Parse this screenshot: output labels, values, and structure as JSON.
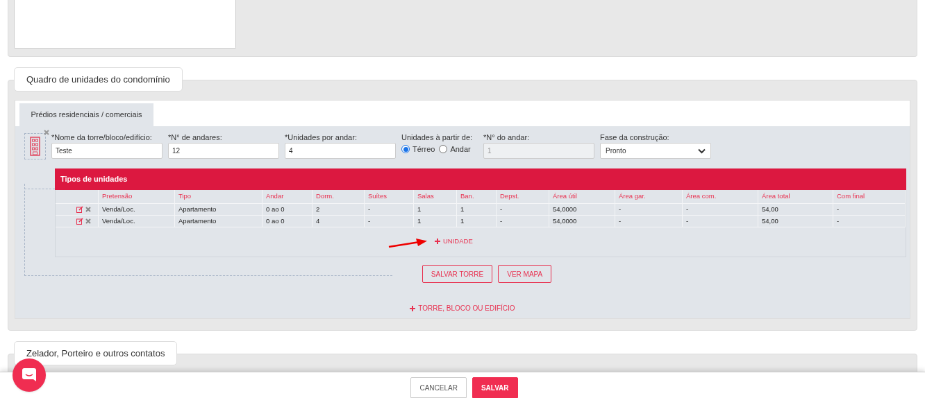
{
  "section_condominio": {
    "title": "Quadro de unidades do condomínio",
    "tabs": [
      {
        "label": "Prédios residenciais / comerciais",
        "selected": true
      }
    ],
    "fields": [
      {
        "kind": "text",
        "label": "*Nome da torre/bloco/edifício:",
        "value": "Teste"
      },
      {
        "kind": "text",
        "label": "*N° de andares:",
        "value": "12"
      },
      {
        "kind": "text",
        "label": "*Unidades por andar:",
        "value": "4"
      },
      {
        "kind": "radio",
        "label": "Unidades à partir de:",
        "options": [
          {
            "label": "Térreo",
            "selected": true
          },
          {
            "label": "Andar",
            "selected": false
          }
        ]
      },
      {
        "kind": "disabled",
        "label": "*N° do andar:",
        "value": "1"
      },
      {
        "kind": "select",
        "label": "Fase da construção:",
        "value": "Pronto"
      }
    ],
    "units": {
      "title": "Tipos de unidades",
      "columns": [
        "Pretensão",
        "Tipo",
        "Andar",
        "Dorm.",
        "Suítes",
        "Salas",
        "Ban.",
        "Depst.",
        "Área útil",
        "Área gar.",
        "Área com.",
        "Área total",
        "Com final"
      ],
      "rows": [
        [
          "Venda/Loc.",
          "Apartamento",
          "0 ao 0",
          "2",
          "-",
          "1",
          "1",
          "-",
          "54,0000",
          "-",
          "-",
          "54,00",
          "-"
        ],
        [
          "Venda/Loc.",
          "Apartamento",
          "0 ao 0",
          "4",
          "-",
          "1",
          "1",
          "-",
          "54,0000",
          "-",
          "-",
          "54,00",
          "-"
        ]
      ],
      "add_label": "UNIDADE"
    },
    "buttons": [
      "SALVAR TORRE",
      "VER MAPA"
    ],
    "add_tower": "TORRE, BLOCO OU EDIFÍCIO"
  },
  "section_contatos": {
    "title": "Zelador, Porteiro e outros contatos"
  },
  "footer": {
    "buttons": [
      {
        "label": "CANCELAR",
        "kind": "secondary"
      },
      {
        "label": "SALVAR",
        "kind": "primary"
      }
    ]
  }
}
